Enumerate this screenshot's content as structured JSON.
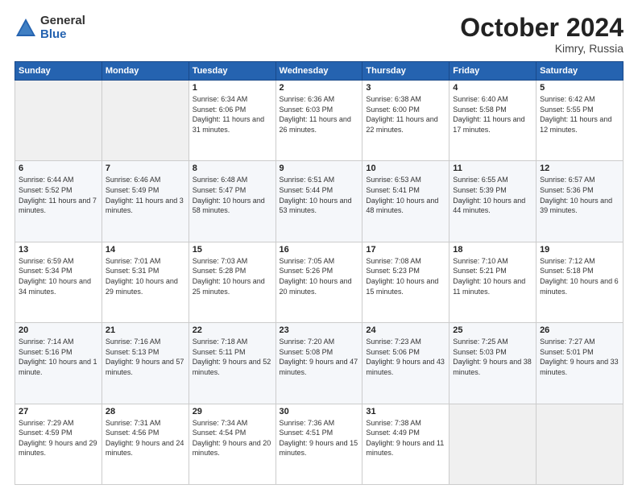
{
  "logo": {
    "general": "General",
    "blue": "Blue"
  },
  "header": {
    "month": "October 2024",
    "location": "Kimry, Russia"
  },
  "weekdays": [
    "Sunday",
    "Monday",
    "Tuesday",
    "Wednesday",
    "Thursday",
    "Friday",
    "Saturday"
  ],
  "weeks": [
    [
      {
        "day": "",
        "info": ""
      },
      {
        "day": "",
        "info": ""
      },
      {
        "day": "1",
        "info": "Sunrise: 6:34 AM\nSunset: 6:06 PM\nDaylight: 11 hours and 31 minutes."
      },
      {
        "day": "2",
        "info": "Sunrise: 6:36 AM\nSunset: 6:03 PM\nDaylight: 11 hours and 26 minutes."
      },
      {
        "day": "3",
        "info": "Sunrise: 6:38 AM\nSunset: 6:00 PM\nDaylight: 11 hours and 22 minutes."
      },
      {
        "day": "4",
        "info": "Sunrise: 6:40 AM\nSunset: 5:58 PM\nDaylight: 11 hours and 17 minutes."
      },
      {
        "day": "5",
        "info": "Sunrise: 6:42 AM\nSunset: 5:55 PM\nDaylight: 11 hours and 12 minutes."
      }
    ],
    [
      {
        "day": "6",
        "info": "Sunrise: 6:44 AM\nSunset: 5:52 PM\nDaylight: 11 hours and 7 minutes."
      },
      {
        "day": "7",
        "info": "Sunrise: 6:46 AM\nSunset: 5:49 PM\nDaylight: 11 hours and 3 minutes."
      },
      {
        "day": "8",
        "info": "Sunrise: 6:48 AM\nSunset: 5:47 PM\nDaylight: 10 hours and 58 minutes."
      },
      {
        "day": "9",
        "info": "Sunrise: 6:51 AM\nSunset: 5:44 PM\nDaylight: 10 hours and 53 minutes."
      },
      {
        "day": "10",
        "info": "Sunrise: 6:53 AM\nSunset: 5:41 PM\nDaylight: 10 hours and 48 minutes."
      },
      {
        "day": "11",
        "info": "Sunrise: 6:55 AM\nSunset: 5:39 PM\nDaylight: 10 hours and 44 minutes."
      },
      {
        "day": "12",
        "info": "Sunrise: 6:57 AM\nSunset: 5:36 PM\nDaylight: 10 hours and 39 minutes."
      }
    ],
    [
      {
        "day": "13",
        "info": "Sunrise: 6:59 AM\nSunset: 5:34 PM\nDaylight: 10 hours and 34 minutes."
      },
      {
        "day": "14",
        "info": "Sunrise: 7:01 AM\nSunset: 5:31 PM\nDaylight: 10 hours and 29 minutes."
      },
      {
        "day": "15",
        "info": "Sunrise: 7:03 AM\nSunset: 5:28 PM\nDaylight: 10 hours and 25 minutes."
      },
      {
        "day": "16",
        "info": "Sunrise: 7:05 AM\nSunset: 5:26 PM\nDaylight: 10 hours and 20 minutes."
      },
      {
        "day": "17",
        "info": "Sunrise: 7:08 AM\nSunset: 5:23 PM\nDaylight: 10 hours and 15 minutes."
      },
      {
        "day": "18",
        "info": "Sunrise: 7:10 AM\nSunset: 5:21 PM\nDaylight: 10 hours and 11 minutes."
      },
      {
        "day": "19",
        "info": "Sunrise: 7:12 AM\nSunset: 5:18 PM\nDaylight: 10 hours and 6 minutes."
      }
    ],
    [
      {
        "day": "20",
        "info": "Sunrise: 7:14 AM\nSunset: 5:16 PM\nDaylight: 10 hours and 1 minute."
      },
      {
        "day": "21",
        "info": "Sunrise: 7:16 AM\nSunset: 5:13 PM\nDaylight: 9 hours and 57 minutes."
      },
      {
        "day": "22",
        "info": "Sunrise: 7:18 AM\nSunset: 5:11 PM\nDaylight: 9 hours and 52 minutes."
      },
      {
        "day": "23",
        "info": "Sunrise: 7:20 AM\nSunset: 5:08 PM\nDaylight: 9 hours and 47 minutes."
      },
      {
        "day": "24",
        "info": "Sunrise: 7:23 AM\nSunset: 5:06 PM\nDaylight: 9 hours and 43 minutes."
      },
      {
        "day": "25",
        "info": "Sunrise: 7:25 AM\nSunset: 5:03 PM\nDaylight: 9 hours and 38 minutes."
      },
      {
        "day": "26",
        "info": "Sunrise: 7:27 AM\nSunset: 5:01 PM\nDaylight: 9 hours and 33 minutes."
      }
    ],
    [
      {
        "day": "27",
        "info": "Sunrise: 7:29 AM\nSunset: 4:59 PM\nDaylight: 9 hours and 29 minutes."
      },
      {
        "day": "28",
        "info": "Sunrise: 7:31 AM\nSunset: 4:56 PM\nDaylight: 9 hours and 24 minutes."
      },
      {
        "day": "29",
        "info": "Sunrise: 7:34 AM\nSunset: 4:54 PM\nDaylight: 9 hours and 20 minutes."
      },
      {
        "day": "30",
        "info": "Sunrise: 7:36 AM\nSunset: 4:51 PM\nDaylight: 9 hours and 15 minutes."
      },
      {
        "day": "31",
        "info": "Sunrise: 7:38 AM\nSunset: 4:49 PM\nDaylight: 9 hours and 11 minutes."
      },
      {
        "day": "",
        "info": ""
      },
      {
        "day": "",
        "info": ""
      }
    ]
  ]
}
